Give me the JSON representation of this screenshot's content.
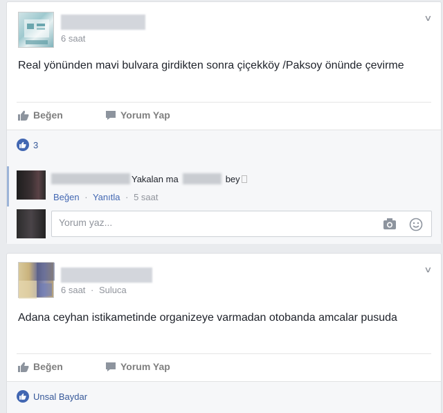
{
  "posts": [
    {
      "time": "6 saat",
      "body": "Real yönünden mavi bulvara girdikten sonra çiçekköy /Paksoy önünde çevirme",
      "actions": {
        "like": "Beğen",
        "comment": "Yorum Yap"
      },
      "like_count": "3",
      "comment": {
        "text_start": "Yakalan ma",
        "text_end": "bey",
        "actions": {
          "like": "Beğen",
          "reply": "Yanıtla",
          "time": "5 saat"
        }
      },
      "write_placeholder": "Yorum yaz..."
    },
    {
      "time": "6 saat",
      "location": "Suluca",
      "body": "Adana ceyhan istikametinde organizeye varmadan otobanda amcalar pusuda",
      "actions": {
        "like": "Beğen",
        "comment": "Yorum Yap"
      },
      "liker": "Unsal Baydar"
    }
  ],
  "separator": "·"
}
